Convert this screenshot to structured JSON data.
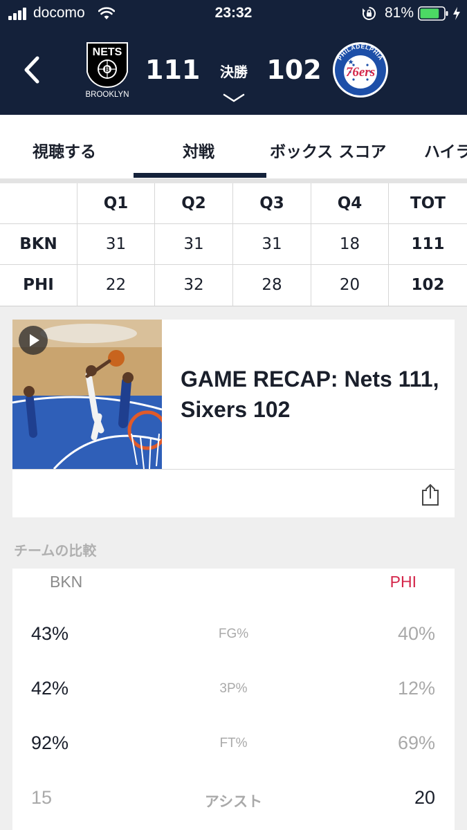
{
  "status_bar": {
    "carrier": "docomo",
    "time": "23:32",
    "battery_percent": "81%",
    "battery_level": 0.81,
    "icons": [
      "signal-icon",
      "wifi-icon",
      "rotation-lock-icon",
      "battery-icon",
      "charging-icon"
    ]
  },
  "game": {
    "home_team": {
      "name": "NETS",
      "city": "BROOKLYN",
      "abbr": "BKN",
      "score": "111",
      "logo": "nets-logo"
    },
    "away_team": {
      "name": "PHILADELPHIA",
      "short": "76ers",
      "abbr": "PHI",
      "score": "102",
      "logo": "sixers-logo"
    },
    "status": "決勝"
  },
  "tabs": [
    {
      "label": "視聴する",
      "active": false
    },
    {
      "label": "対戦",
      "active": true
    },
    {
      "label": "ボックス スコア",
      "active": false
    },
    {
      "label": "ハイライト",
      "active": false
    }
  ],
  "linescore": {
    "headers": [
      "",
      "Q1",
      "Q2",
      "Q3",
      "Q4",
      "TOT"
    ],
    "rows": [
      [
        "BKN",
        "31",
        "31",
        "31",
        "18",
        "111"
      ],
      [
        "PHI",
        "22",
        "32",
        "28",
        "20",
        "102"
      ]
    ]
  },
  "recap": {
    "title": "GAME RECAP: Nets 111, Sixers 102",
    "thumbnail": "basketball-game-photo",
    "play_icon": "play-icon",
    "share_icon": "share-icon"
  },
  "comparison": {
    "section_title": "チームの比較",
    "home_abbr": "BKN",
    "away_abbr": "PHI",
    "stats": [
      {
        "label": "FG%",
        "home": "43%",
        "away": "40%"
      },
      {
        "label": "3P%",
        "home": "42%",
        "away": "12%"
      },
      {
        "label": "FT%",
        "home": "92%",
        "away": "69%"
      },
      {
        "label": "アシスト",
        "home": "15",
        "away": "20"
      }
    ]
  },
  "colors": {
    "header_bg": "#14213a",
    "phi_red": "#d4264a",
    "phi_blue": "#1d4fa8",
    "battery_green": "#4cd964"
  }
}
